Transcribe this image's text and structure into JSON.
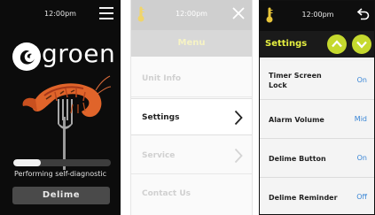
{
  "colors": {
    "accent_yellow_green": "#c5d92e",
    "settings_title": "#e5ef40",
    "value_blue": "#3a86d6",
    "thermometer": "#e8c53a",
    "shrimp": "#e0642a"
  },
  "splash": {
    "time": "12:00pm",
    "menu_icon": "hamburger-icon",
    "brand": "groen",
    "progress_fraction": 0.28,
    "status": "Performing self-diagnostic",
    "delime_label": "Delime"
  },
  "menu": {
    "time": "12:00pm",
    "thermometer_icon": "thermometer-icon",
    "close_icon": "close-icon",
    "title": "Menu",
    "items": [
      {
        "label": "Unit Info",
        "active": false,
        "chevron": false
      },
      {
        "label": "Settings",
        "active": true,
        "chevron": true
      },
      {
        "label": "Service",
        "active": false,
        "chevron": true
      },
      {
        "label": "Contact Us",
        "active": false,
        "chevron": false
      }
    ]
  },
  "settings": {
    "time": "12:00pm",
    "thermometer_icon": "thermometer-icon",
    "back_icon": "back-arrow-icon",
    "title": "Settings",
    "up_icon": "chevron-up-icon",
    "down_icon": "chevron-down-icon",
    "rows": [
      {
        "label": "Timer Screen Lock",
        "value": "On"
      },
      {
        "label": "Alarm Volume",
        "value": "Mid"
      },
      {
        "label": "Delime Button",
        "value": "On"
      },
      {
        "label": "Delime Reminder",
        "value": "Off"
      }
    ]
  }
}
